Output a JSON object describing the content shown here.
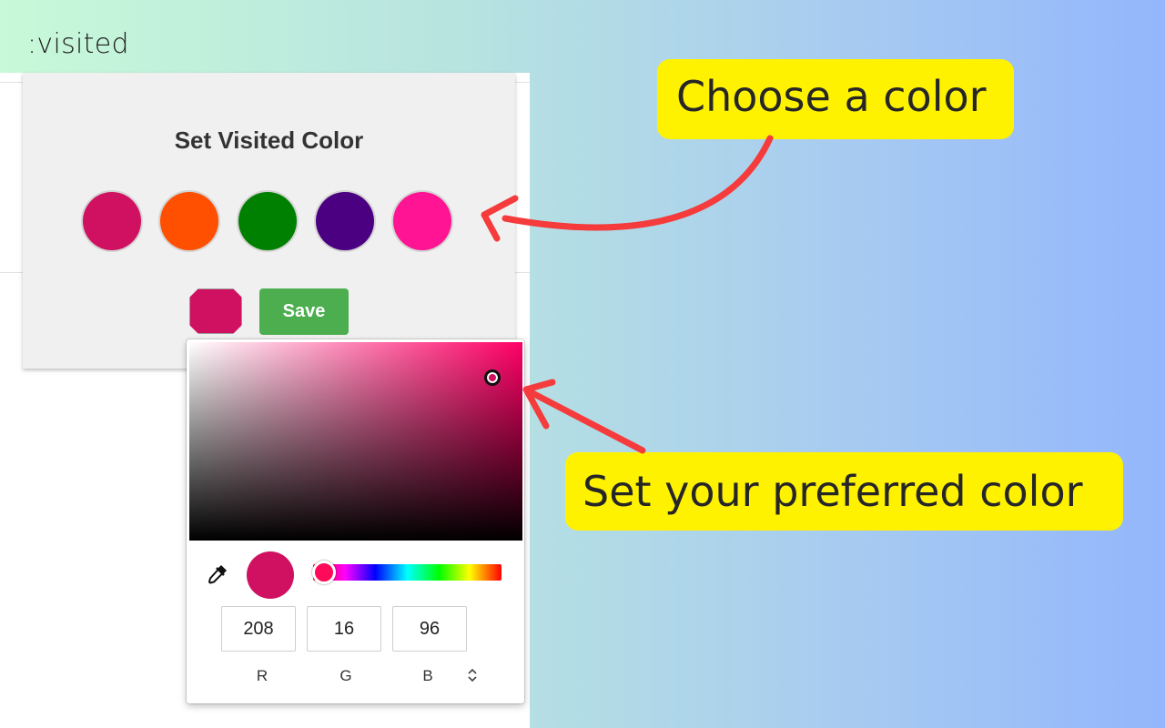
{
  "brand": ":visited",
  "popup": {
    "title": "Set Visited Color",
    "swatches": [
      {
        "name": "crimson",
        "color": "#d01060"
      },
      {
        "name": "orange",
        "color": "#ff4f00"
      },
      {
        "name": "green",
        "color": "#008000"
      },
      {
        "name": "indigo",
        "color": "#4b0082"
      },
      {
        "name": "pink",
        "color": "#ff1493"
      }
    ],
    "current_color": "#d01060",
    "save_label": "Save"
  },
  "picker": {
    "eyedropper_icon": "eyedropper-icon",
    "hue_color": "#ff0066",
    "rgb": {
      "r": "208",
      "g": "16",
      "b": "96"
    },
    "labels": {
      "r": "R",
      "g": "G",
      "b": "B"
    },
    "mode_toggle_icon": "up-down-chevron-icon"
  },
  "callouts": {
    "choose": "Choose a color",
    "set": "Set your preferred color"
  },
  "colors": {
    "callout_bg": "#fff200",
    "arrow": "#f53b3b",
    "save_bg": "#4cae4f"
  }
}
